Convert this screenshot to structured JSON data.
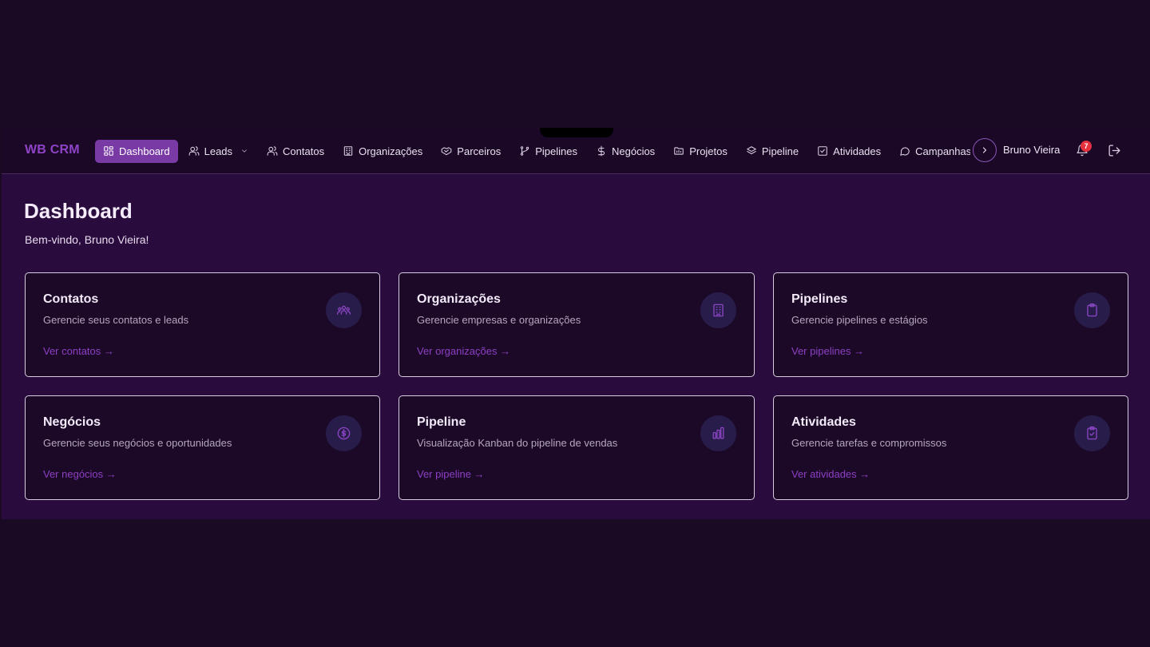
{
  "brand": "WB CRM",
  "nav": {
    "items": [
      {
        "label": "Dashboard",
        "icon": "dashboard-grid-icon",
        "active": true
      },
      {
        "label": "Leads",
        "icon": "users-icon",
        "dropdown": true
      },
      {
        "label": "Contatos",
        "icon": "contacts-icon"
      },
      {
        "label": "Organizações",
        "icon": "building-icon"
      },
      {
        "label": "Parceiros",
        "icon": "handshake-icon"
      },
      {
        "label": "Pipelines",
        "icon": "git-branch-icon"
      },
      {
        "label": "Negócios",
        "icon": "dollar-icon"
      },
      {
        "label": "Projetos",
        "icon": "folder-icon"
      },
      {
        "label": "Pipeline",
        "icon": "layers-icon"
      },
      {
        "label": "Atividades",
        "icon": "check-square-icon"
      },
      {
        "label": "Campanhas",
        "icon": "message-circle-icon"
      }
    ]
  },
  "user": {
    "name": "Bruno Vieira",
    "notifications": "7"
  },
  "page": {
    "title": "Dashboard",
    "welcome": "Bem-vindo, Bruno Vieira!"
  },
  "cards": [
    {
      "title": "Contatos",
      "desc": "Gerencie seus contatos e leads",
      "link": "Ver contatos →",
      "icon": "users-group-icon"
    },
    {
      "title": "Organizações",
      "desc": "Gerencie empresas e organizações",
      "link": "Ver organizações →",
      "icon": "building-icon"
    },
    {
      "title": "Pipelines",
      "desc": "Gerencie pipelines e estágios",
      "link": "Ver pipelines →",
      "icon": "clipboard-icon"
    },
    {
      "title": "Negócios",
      "desc": "Gerencie seus negócios e oportunidades",
      "link": "Ver negócios →",
      "icon": "dollar-circle-icon"
    },
    {
      "title": "Pipeline",
      "desc": "Visualização Kanban do pipeline de vendas",
      "link": "Ver pipeline →",
      "icon": "bar-chart-icon"
    },
    {
      "title": "Atividades",
      "desc": "Gerencie tarefas e compromissos",
      "link": "Ver atividades →",
      "icon": "clipboard-check-icon"
    }
  ],
  "colors": {
    "accent": "#7a3aa6",
    "link": "#8d3fc4",
    "background": "#2a0b3e",
    "badge": "#e5303d"
  }
}
